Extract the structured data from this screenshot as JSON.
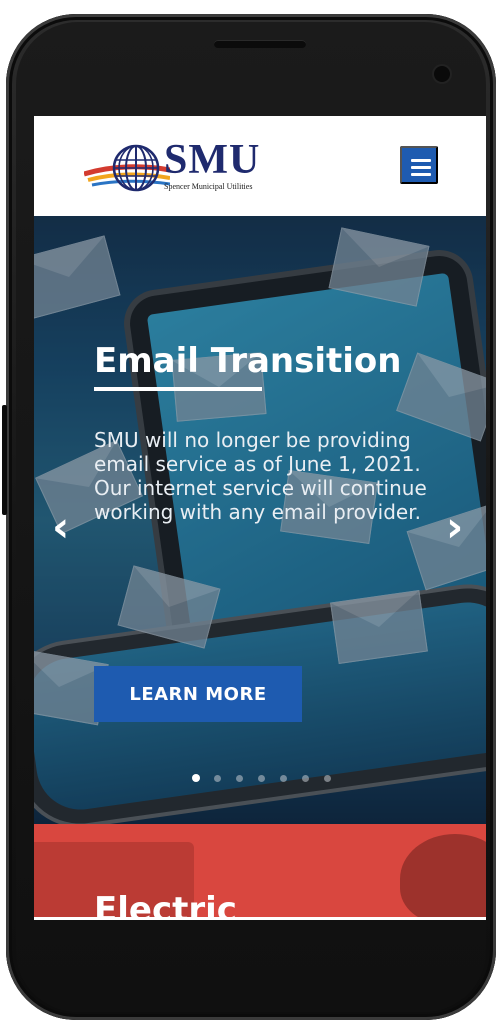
{
  "header": {
    "logo_text": "SMU",
    "logo_subtext": "Spencer Municipal Utilities",
    "menu_icon": "hamburger-icon"
  },
  "hero": {
    "title": "Email Transition",
    "body": "SMU will no longer be providing email service as of June 1, 2021. Our internet service will continue working with any email provider.",
    "button_label": "LEARN MORE",
    "prev_icon": "chevron-left-icon",
    "next_icon": "chevron-right-icon",
    "slide_count": 7,
    "active_slide": 1
  },
  "next_section": {
    "title": "Electric"
  },
  "colors": {
    "brand_blue": "#1e5bb0",
    "electric_red": "#d9473f",
    "logo_navy": "#1f2a6e"
  }
}
